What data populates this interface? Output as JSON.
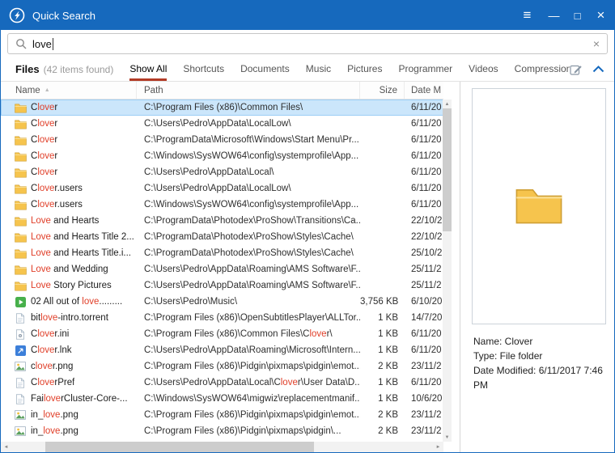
{
  "colors": {
    "titlebar": "#1669bd",
    "tab_underline": "#b23b26",
    "highlight": "#e03e28",
    "selection": "#cbe6fb",
    "selection_border": "#9ccef5"
  },
  "window": {
    "title": "Quick Search",
    "menu_icon": "≡",
    "minimize_icon": "—",
    "maximize_icon": "□",
    "close_icon": "×"
  },
  "search": {
    "query": "love",
    "clear_icon": "×"
  },
  "tabs": {
    "files_label": "Files",
    "count_label": "(42 items found)",
    "active": "Show All",
    "items": [
      "Show All",
      "Shortcuts",
      "Documents",
      "Music",
      "Pictures",
      "Programmer",
      "Videos",
      "Compression"
    ]
  },
  "table": {
    "sort_icon": "▲",
    "columns": {
      "name": "Name",
      "path": "Path",
      "size": "Size",
      "date": "Date M"
    },
    "rows": [
      {
        "icon": "folder",
        "selected": true,
        "name": [
          {
            "t": "C"
          },
          {
            "t": "love",
            "h": true
          },
          {
            "t": "r"
          }
        ],
        "path": [
          {
            "t": "C:\\Program Files (x86)\\Common Files\\"
          }
        ],
        "size": "",
        "date": "6/11/20"
      },
      {
        "icon": "folder",
        "name": [
          {
            "t": "C"
          },
          {
            "t": "love",
            "h": true
          },
          {
            "t": "r"
          }
        ],
        "path": [
          {
            "t": "C:\\Users\\Pedro\\AppData\\LocalLow\\"
          }
        ],
        "size": "",
        "date": "6/11/20"
      },
      {
        "icon": "folder",
        "name": [
          {
            "t": "C"
          },
          {
            "t": "love",
            "h": true
          },
          {
            "t": "r"
          }
        ],
        "path": [
          {
            "t": "C:\\ProgramData\\Microsoft\\Windows\\Start Menu\\Pr..."
          }
        ],
        "size": "",
        "date": "6/11/20"
      },
      {
        "icon": "folder",
        "name": [
          {
            "t": "C"
          },
          {
            "t": "love",
            "h": true
          },
          {
            "t": "r"
          }
        ],
        "path": [
          {
            "t": "C:\\Windows\\SysWOW64\\config\\systemprofile\\App..."
          }
        ],
        "size": "",
        "date": "6/11/20"
      },
      {
        "icon": "folder",
        "name": [
          {
            "t": "C"
          },
          {
            "t": "love",
            "h": true
          },
          {
            "t": "r"
          }
        ],
        "path": [
          {
            "t": "C:\\Users\\Pedro\\AppData\\Local\\"
          }
        ],
        "size": "",
        "date": "6/11/20"
      },
      {
        "icon": "folder",
        "name": [
          {
            "t": "C"
          },
          {
            "t": "love",
            "h": true
          },
          {
            "t": "r.users"
          }
        ],
        "path": [
          {
            "t": "C:\\Users\\Pedro\\AppData\\LocalLow\\"
          }
        ],
        "size": "",
        "date": "6/11/20"
      },
      {
        "icon": "folder",
        "name": [
          {
            "t": "C"
          },
          {
            "t": "love",
            "h": true
          },
          {
            "t": "r.users"
          }
        ],
        "path": [
          {
            "t": "C:\\Windows\\SysWOW64\\config\\systemprofile\\App..."
          }
        ],
        "size": "",
        "date": "6/11/20"
      },
      {
        "icon": "folder",
        "name": [
          {
            "t": "Love",
            "h": true
          },
          {
            "t": " and Hearts"
          }
        ],
        "path": [
          {
            "t": "C:\\ProgramData\\Photodex\\ProShow\\Transitions\\Ca..."
          }
        ],
        "size": "",
        "date": "22/10/2"
      },
      {
        "icon": "folder",
        "name": [
          {
            "t": "Love",
            "h": true
          },
          {
            "t": " and Hearts Title 2..."
          }
        ],
        "path": [
          {
            "t": "C:\\ProgramData\\Photodex\\ProShow\\Styles\\Cache\\"
          }
        ],
        "size": "",
        "date": "22/10/2"
      },
      {
        "icon": "folder",
        "name": [
          {
            "t": "Love",
            "h": true
          },
          {
            "t": " and Hearts Title.i..."
          }
        ],
        "path": [
          {
            "t": "C:\\ProgramData\\Photodex\\ProShow\\Styles\\Cache\\"
          }
        ],
        "size": "",
        "date": "25/10/2"
      },
      {
        "icon": "folder",
        "name": [
          {
            "t": "Love",
            "h": true
          },
          {
            "t": " and Wedding"
          }
        ],
        "path": [
          {
            "t": "C:\\Users\\Pedro\\AppData\\Roaming\\AMS Software\\F..."
          }
        ],
        "size": "",
        "date": "25/11/2"
      },
      {
        "icon": "folder",
        "name": [
          {
            "t": "Love",
            "h": true
          },
          {
            "t": " Story Pictures"
          }
        ],
        "path": [
          {
            "t": "C:\\Users\\Pedro\\AppData\\Roaming\\AMS Software\\F..."
          }
        ],
        "size": "",
        "date": "25/11/2"
      },
      {
        "icon": "media",
        "name": [
          {
            "t": "02 All out of "
          },
          {
            "t": "love",
            "h": true
          },
          {
            "t": "........."
          }
        ],
        "path": [
          {
            "t": "C:\\Users\\Pedro\\Music\\"
          }
        ],
        "size": "3,756 KB",
        "date": "6/10/20"
      },
      {
        "icon": "doc",
        "name": [
          {
            "t": "bit"
          },
          {
            "t": "love",
            "h": true
          },
          {
            "t": "-intro.torrent"
          }
        ],
        "path": [
          {
            "t": "C:\\Program Files (x86)\\OpenSubtitlesPlayer\\ALLTor..."
          }
        ],
        "size": "1 KB",
        "date": "14/7/20"
      },
      {
        "icon": "ini",
        "name": [
          {
            "t": "C"
          },
          {
            "t": "love",
            "h": true
          },
          {
            "t": "r.ini"
          }
        ],
        "path": [
          {
            "t": "C:\\Program Files (x86)\\Common Files\\C"
          },
          {
            "t": "love",
            "h": true
          },
          {
            "t": "r\\"
          }
        ],
        "size": "1 KB",
        "date": "6/11/20"
      },
      {
        "icon": "lnk",
        "name": [
          {
            "t": "C"
          },
          {
            "t": "love",
            "h": true
          },
          {
            "t": "r.lnk"
          }
        ],
        "path": [
          {
            "t": "C:\\Users\\Pedro\\AppData\\Roaming\\Microsoft\\Intern..."
          }
        ],
        "size": "1 KB",
        "date": "6/11/20"
      },
      {
        "icon": "image",
        "name": [
          {
            "t": "c"
          },
          {
            "t": "love",
            "h": true
          },
          {
            "t": "r.png"
          }
        ],
        "path": [
          {
            "t": "C:\\Program Files (x86)\\Pidgin\\pixmaps\\pidgin\\emot..."
          }
        ],
        "size": "2 KB",
        "date": "23/11/2"
      },
      {
        "icon": "doc",
        "name": [
          {
            "t": "C"
          },
          {
            "t": "love",
            "h": true
          },
          {
            "t": "rPref"
          }
        ],
        "path": [
          {
            "t": "C:\\Users\\Pedro\\AppData\\Local\\C"
          },
          {
            "t": "love",
            "h": true
          },
          {
            "t": "r\\User Data\\D..."
          }
        ],
        "size": "1 KB",
        "date": "6/11/20"
      },
      {
        "icon": "doc",
        "name": [
          {
            "t": "Fai"
          },
          {
            "t": "love",
            "h": true
          },
          {
            "t": "rCluster-Core-..."
          }
        ],
        "path": [
          {
            "t": "C:\\Windows\\SysWOW64\\migwiz\\replacementmanif..."
          }
        ],
        "size": "1 KB",
        "date": "10/6/20"
      },
      {
        "icon": "image",
        "name": [
          {
            "t": "in_"
          },
          {
            "t": "love",
            "h": true
          },
          {
            "t": ".png"
          }
        ],
        "path": [
          {
            "t": "C:\\Program Files (x86)\\Pidgin\\pixmaps\\pidgin\\emot..."
          }
        ],
        "size": "2 KB",
        "date": "23/11/2"
      },
      {
        "icon": "image",
        "name": [
          {
            "t": "in_"
          },
          {
            "t": "love",
            "h": true
          },
          {
            "t": ".png"
          }
        ],
        "path": [
          {
            "t": "C:\\Program Files (x86)\\Pidgin\\pixmaps\\pidgin\\..."
          }
        ],
        "size": "2 KB",
        "date": "23/11/2"
      }
    ]
  },
  "scrollbars": {
    "up": "▲",
    "down": "▼",
    "left": "◄",
    "right": "►"
  },
  "preview": {
    "name": "Name: Clover",
    "type": "Type: File folder",
    "date_modified": "Date Modified: 6/11/2017 7:46 PM"
  }
}
